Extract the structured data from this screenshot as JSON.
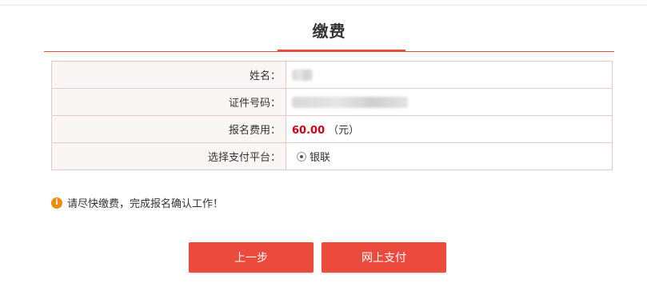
{
  "page": {
    "title": "缴费"
  },
  "form": {
    "rows": [
      {
        "label": "姓名："
      },
      {
        "label": "证件号码："
      },
      {
        "label": "报名费用："
      },
      {
        "label": "选择支付平台："
      }
    ],
    "fee": {
      "amount": "60.00",
      "unit": "（元）"
    },
    "payment_option": {
      "label": "银联",
      "selected": true
    }
  },
  "notice": {
    "text": "请尽快缴费，完成报名确认工作！",
    "icon": "info-icon",
    "icon_glyph": "i",
    "icon_color": "#f08c16"
  },
  "buttons": {
    "prev_label": "上一步",
    "pay_label": "网上支付",
    "color": "#eb4a3c"
  },
  "colors": {
    "accent": "#e74c3c",
    "fee_text": "#d0021b"
  }
}
